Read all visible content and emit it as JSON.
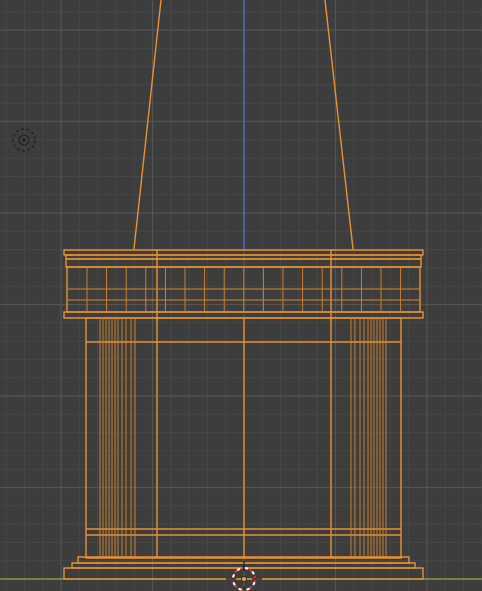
{
  "viewport": {
    "background_color": "#3d3d3d",
    "grid_minor_color": "#474747",
    "grid_major_color": "#545454"
  },
  "axes": {
    "z_axis_color": "#4d6fb8",
    "x_axis_color": "#7d9c3f"
  },
  "selection": {
    "outline_color": "#e8922e",
    "inner_wire_color": "#d9862a"
  },
  "scene": {
    "selected_object": "spire-column",
    "icons": {
      "light": "light-icon",
      "cursor": "3d-cursor-icon",
      "origin": "object-origin-icon"
    }
  }
}
